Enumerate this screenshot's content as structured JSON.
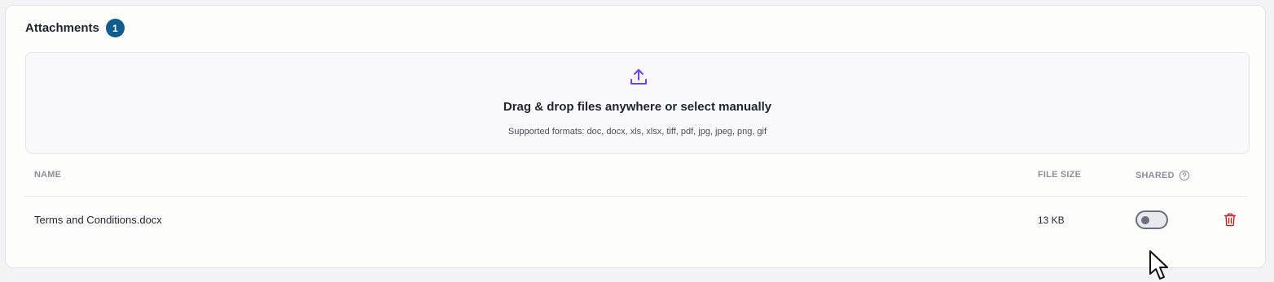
{
  "attachments": {
    "title": "Attachments",
    "count": "1"
  },
  "dropzone": {
    "icon": "upload-icon",
    "title": "Drag & drop files anywhere or select manually",
    "subtitle": "Supported formats: doc, docx, xls, xlsx, tiff, pdf, jpg, jpeg, png, gif"
  },
  "table": {
    "columns": {
      "name": "NAME",
      "file_size": "FILE SIZE",
      "shared": "SHARED"
    },
    "rows": [
      {
        "name": "Terms and Conditions.docx",
        "file_size": "13 KB",
        "shared": false
      }
    ]
  },
  "colors": {
    "badge": "#0f5c8f",
    "upload_icon": "#6d3ff5",
    "delete_icon": "#d11a1a",
    "toggle_off": "#6b6e7d"
  }
}
